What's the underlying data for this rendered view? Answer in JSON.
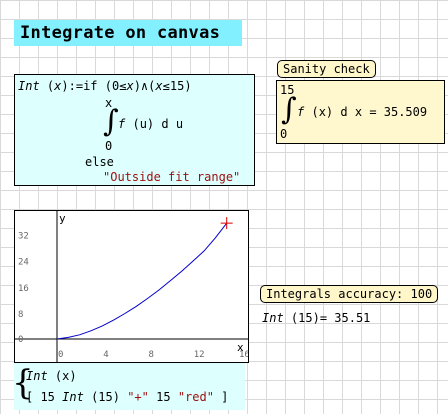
{
  "title": "Integrate on canvas",
  "definition": {
    "fname": "Int",
    "param": "x",
    "assign_if": ":=if",
    "cond_open": "(",
    "cond_0": "0",
    "le1": "≤",
    "cond_x1": "x",
    "cond_mid": ")∧(",
    "cond_x2": "x",
    "le2": "≤",
    "cond_15": "15",
    "cond_close": ")",
    "upper": "x",
    "lower": "0",
    "integrand": "f",
    "integrand_var": "(u)",
    "diff": "d u",
    "else": "else",
    "fallback": "\"Outside fit range\""
  },
  "sanity": {
    "label": "Sanity check",
    "upper": "15",
    "lower": "0",
    "integrand": "f",
    "integrand_var": "(x)",
    "diff": "d x",
    "result": "= 35.509"
  },
  "accuracy": {
    "label": "Integrals accuracy: 100",
    "call_name": "Int",
    "call_arg": "(15)",
    "call_result": "= 35.51"
  },
  "plot_expr": {
    "line1_name": "Int",
    "line1_arg": "(x)",
    "row_open": "[ 15",
    "row_fn": "Int",
    "row_arg": "(15)",
    "row_marker": "\"+\"",
    "row_15": "15",
    "row_color": "\"red\"",
    "row_close": "]"
  },
  "chart_data": {
    "type": "line",
    "xlabel": "x",
    "ylabel": "y",
    "xlim": [
      0,
      16
    ],
    "ylim": [
      0,
      38
    ],
    "xticks": [
      "0",
      "4",
      "8",
      "12",
      "16"
    ],
    "yticks": [
      "0",
      "8",
      "16",
      "24",
      "32"
    ],
    "series": [
      {
        "x": [
          0,
          1,
          2,
          3,
          4,
          5,
          6,
          7,
          8,
          9,
          10,
          11,
          12,
          13,
          14,
          15
        ],
        "y": [
          0,
          0.5,
          1.3,
          2.5,
          4.0,
          5.8,
          7.8,
          10.0,
          12.4,
          15.0,
          17.8,
          20.7,
          23.8,
          27.0,
          31.0,
          35.5
        ],
        "color": "#0000cc"
      }
    ],
    "marker": {
      "x": 15,
      "y": 35.51,
      "symbol": "+",
      "color": "#dd0000"
    }
  }
}
